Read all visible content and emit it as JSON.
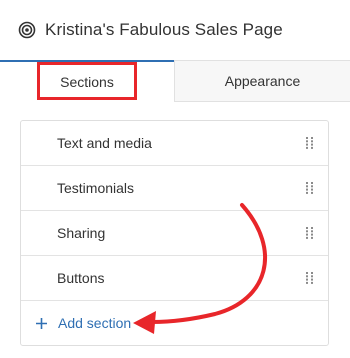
{
  "header": {
    "title": "Kristina's Fabulous Sales Page",
    "icon": "target-icon"
  },
  "tabs": [
    {
      "label": "Sections",
      "active": true
    },
    {
      "label": "Appearance",
      "active": false
    }
  ],
  "sections": {
    "items": [
      {
        "label": "Text and media"
      },
      {
        "label": "Testimonials"
      },
      {
        "label": "Sharing"
      },
      {
        "label": "Buttons"
      }
    ],
    "add_label": "Add section"
  },
  "colors": {
    "accent": "#2f6fb3",
    "annotation": "#e8262a"
  }
}
